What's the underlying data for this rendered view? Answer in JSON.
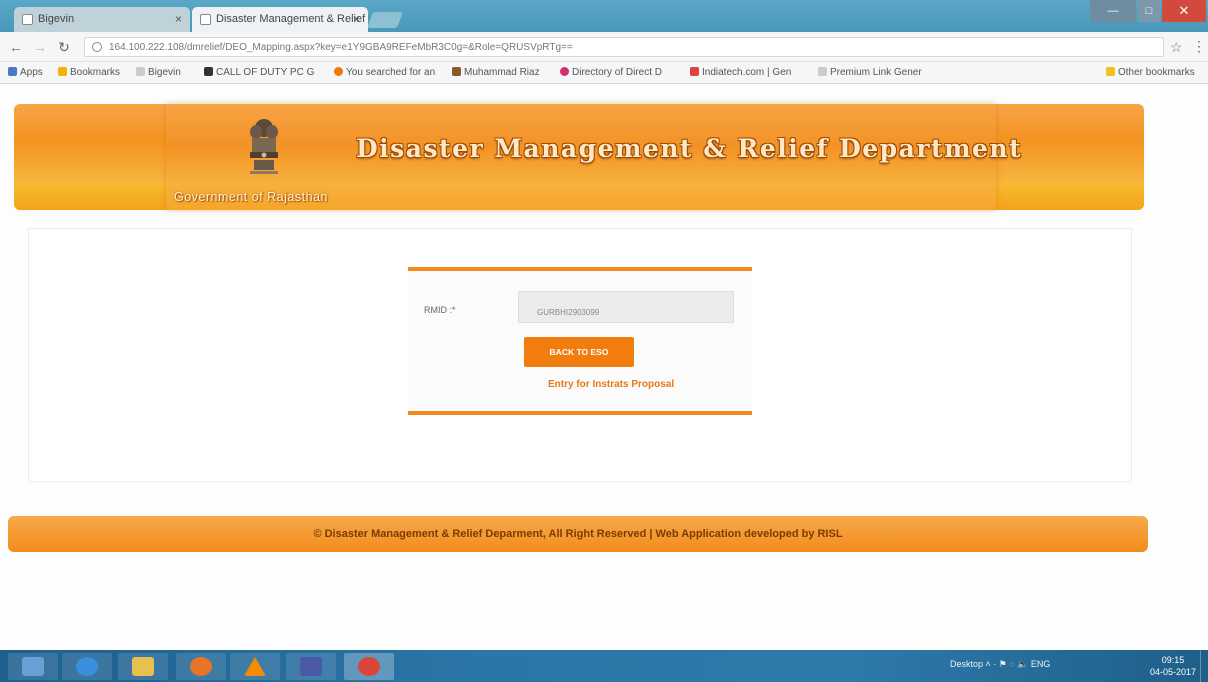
{
  "browser": {
    "tabs": [
      {
        "label": "Bigevin",
        "active": false
      },
      {
        "label": "Disaster Management & Relief",
        "active": true
      }
    ],
    "window_controls": {
      "minimize": "—",
      "maximize": "□",
      "close": "✕"
    },
    "address": "164.100.222.108/dmrelief/DEO_Mapping.aspx?key=e1Y9GBA9REFeMbR3C0g=&Role=QRUSVpRTg==",
    "bookmarks": [
      {
        "label": "Apps",
        "color": "#4a78c4"
      },
      {
        "label": "Bookmarks",
        "color": "#f2b400"
      },
      {
        "label": "Bigevin",
        "color": "#cccccc"
      },
      {
        "label": "CALL OF DUTY PC G",
        "color": "#333333"
      },
      {
        "label": "You searched for an",
        "color": "#f07a00"
      },
      {
        "label": "Muhammad Riaz",
        "color": "#8a5a2a"
      },
      {
        "label": "Directory of Direct D",
        "color": "#d0306a"
      },
      {
        "label": "Indiatech.com | Gen",
        "color": "#e04040"
      },
      {
        "label": "Premium Link Gener",
        "color": "#cccccc"
      },
      {
        "label": "Other bookmarks",
        "color": "#f2c21a"
      }
    ]
  },
  "header": {
    "title": "Disaster Management & Relief Department",
    "subtitle": "Government of Rajasthan"
  },
  "form": {
    "rmid_label": "RMID :*",
    "rmid_value": "GURBHI2903099",
    "back_button": "BACK TO ESO",
    "entry_link": "Entry for Instrats Proposal"
  },
  "footer": {
    "text": "© Disaster Management & Relief Deparment, All Right Reserved | Web Application developed by RISL"
  },
  "taskbar": {
    "apps": [
      {
        "name": "explorer",
        "color": "#6a9fd6"
      },
      {
        "name": "internet-explorer",
        "color": "#3a8fe0"
      },
      {
        "name": "file-manager",
        "color": "#e7c04d"
      },
      {
        "name": "firefox",
        "color": "#e8742a"
      },
      {
        "name": "vlc",
        "color": "#f28c00"
      },
      {
        "name": "app",
        "color": "#4a5aa8"
      },
      {
        "name": "chrome",
        "color": "#d9463a"
      }
    ],
    "tray": "Desktop  ˄  ·  ⚑  ◌  🔈  ENG",
    "time": "09:15",
    "date": "04-05-2017"
  }
}
